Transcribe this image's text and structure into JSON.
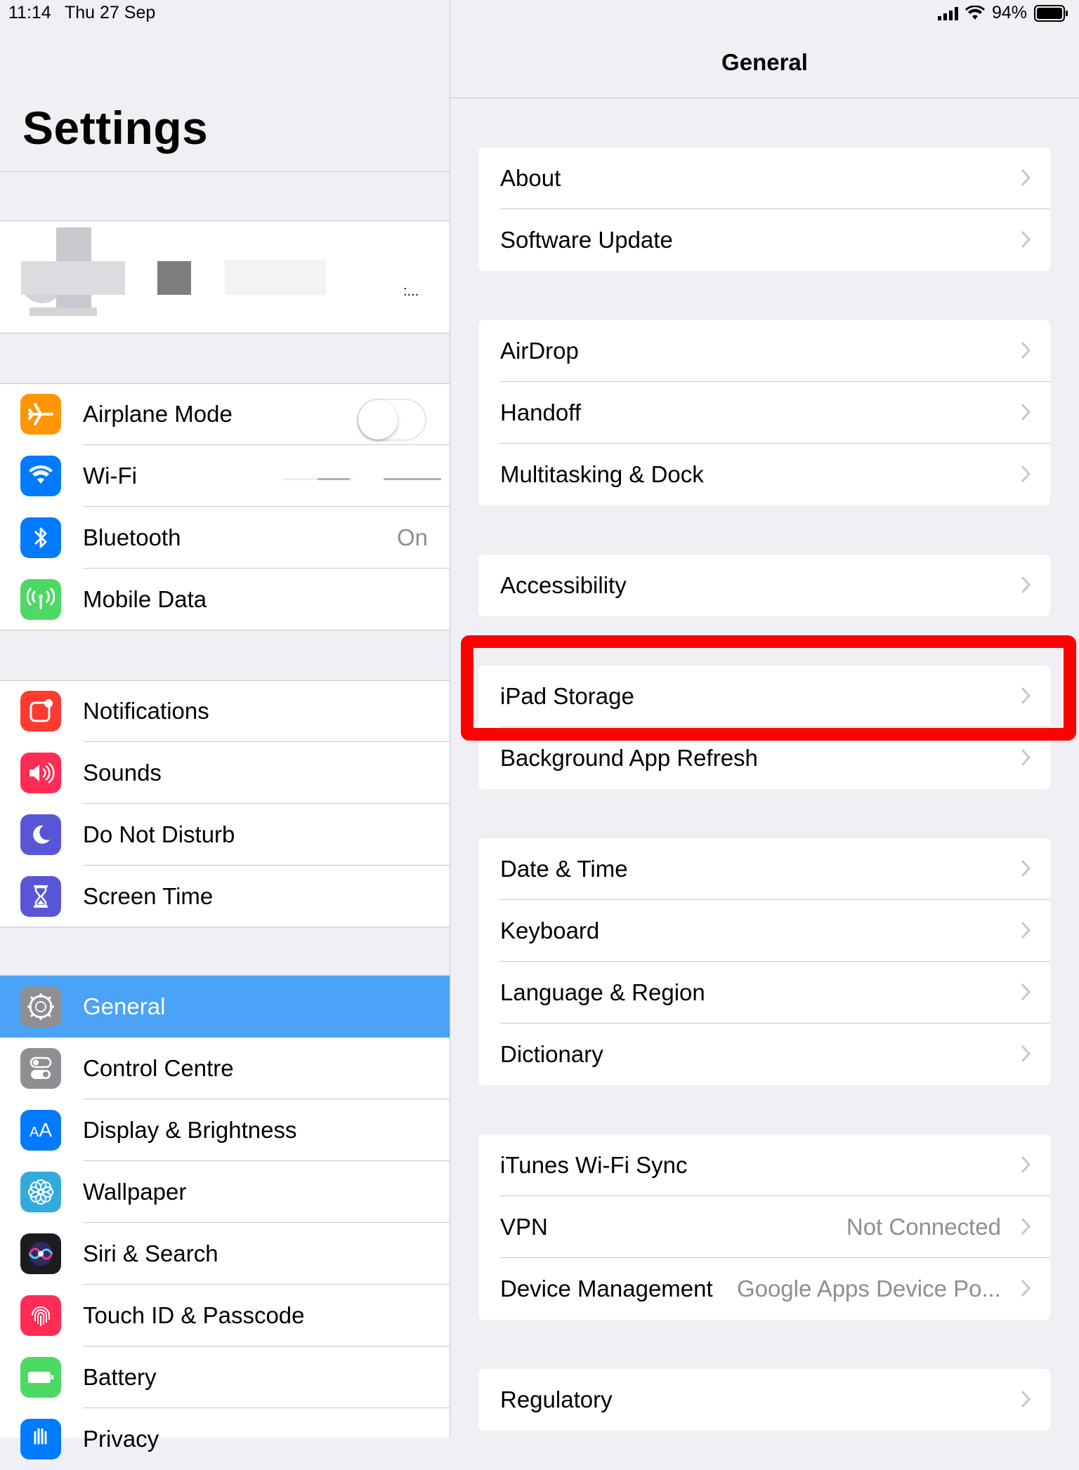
{
  "status_bar": {
    "time": "11:14",
    "date": "Thu 27 Sep",
    "battery_text": "94%"
  },
  "left": {
    "title": "Settings",
    "profile": {
      "detail": ":..."
    },
    "group1": [
      {
        "label": "Airplane Mode",
        "icon": "airplane-icon",
        "color": "#ff9500",
        "toggle": false
      },
      {
        "label": "Wi-Fi",
        "icon": "wifi-icon",
        "color": "#007aff"
      },
      {
        "label": "Bluetooth",
        "icon": "bluetooth-icon",
        "color": "#007aff",
        "value": "On"
      },
      {
        "label": "Mobile Data",
        "icon": "antenna-icon",
        "color": "#4cd964"
      }
    ],
    "group2": [
      {
        "label": "Notifications",
        "icon": "notifications-icon",
        "color": "#ff3b30"
      },
      {
        "label": "Sounds",
        "icon": "speaker-icon",
        "color": "#ff2d55"
      },
      {
        "label": "Do Not Disturb",
        "icon": "moon-icon",
        "color": "#5856d6"
      },
      {
        "label": "Screen Time",
        "icon": "hourglass-icon",
        "color": "#5856d6"
      }
    ],
    "group3": [
      {
        "label": "General",
        "icon": "gear-icon",
        "color": "#8e8e93",
        "selected": true
      },
      {
        "label": "Control Centre",
        "icon": "switches-icon",
        "color": "#8e8e93"
      },
      {
        "label": "Display & Brightness",
        "icon": "text-size-icon",
        "color": "#007aff"
      },
      {
        "label": "Wallpaper",
        "icon": "flower-icon",
        "color": "#34aadc"
      },
      {
        "label": "Siri & Search",
        "icon": "siri-icon",
        "color": "#1c1c1e"
      },
      {
        "label": "Touch ID & Passcode",
        "icon": "fingerprint-icon",
        "color": "#ff2d55"
      },
      {
        "label": "Battery",
        "icon": "battery-icon",
        "color": "#4cd964"
      },
      {
        "label": "Privacy",
        "icon": "hand-icon",
        "color": "#007aff"
      }
    ]
  },
  "right": {
    "nav_title": "General",
    "groups": [
      [
        {
          "label": "About"
        },
        {
          "label": "Software Update"
        }
      ],
      [
        {
          "label": "AirDrop"
        },
        {
          "label": "Handoff"
        },
        {
          "label": "Multitasking & Dock"
        }
      ],
      [
        {
          "label": "Accessibility"
        }
      ],
      [
        {
          "label": "iPad Storage"
        },
        {
          "label": "Background App Refresh"
        }
      ],
      [
        {
          "label": "Date & Time"
        },
        {
          "label": "Keyboard"
        },
        {
          "label": "Language & Region"
        },
        {
          "label": "Dictionary"
        }
      ],
      [
        {
          "label": "iTunes Wi-Fi Sync"
        },
        {
          "label": "VPN",
          "value": "Not Connected"
        },
        {
          "label": "Device Management",
          "value": "Google Apps Device Po..."
        }
      ],
      [
        {
          "label": "Regulatory"
        }
      ]
    ],
    "highlight_color": "#ff0000"
  }
}
